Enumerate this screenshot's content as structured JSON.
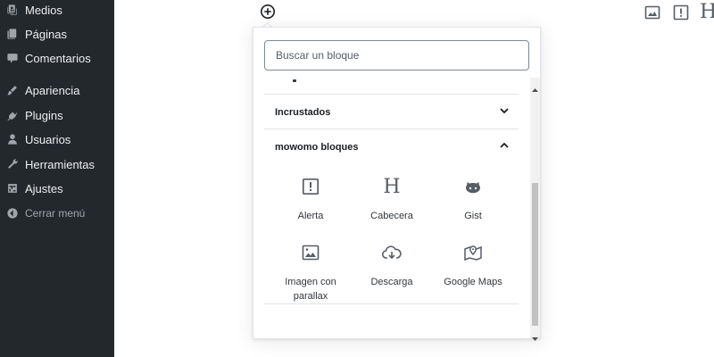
{
  "sidebar": {
    "items": [
      {
        "label": "Medios",
        "icon": "media-icon"
      },
      {
        "label": "Páginas",
        "icon": "pages-icon"
      },
      {
        "label": "Comentarios",
        "icon": "comments-icon"
      },
      {
        "label": "Apariencia",
        "icon": "appearance-icon"
      },
      {
        "label": "Plugins",
        "icon": "plugins-icon"
      },
      {
        "label": "Usuarios",
        "icon": "users-icon"
      },
      {
        "label": "Herramientas",
        "icon": "tools-icon"
      },
      {
        "label": "Ajustes",
        "icon": "settings-icon"
      }
    ],
    "collapse_label": "Cerrar menú"
  },
  "toolbar": {
    "inserter_icon": "plus-circle-icon",
    "right_icons": [
      "image-icon",
      "alert-icon",
      "heading-icon"
    ],
    "heading_glyph": "H"
  },
  "inserter": {
    "search_placeholder": "Buscar un bloque",
    "panels": [
      {
        "title": "Incrustados",
        "expanded": false
      },
      {
        "title": "mowomo bloques",
        "expanded": true
      }
    ],
    "blocks": [
      {
        "label": "Alerta",
        "icon": "alert-icon"
      },
      {
        "label": "Cabecera",
        "icon": "heading-icon",
        "glyph": "H"
      },
      {
        "label": "Gist",
        "icon": "github-icon"
      },
      {
        "label": "Imagen con parallax",
        "icon": "image-icon"
      },
      {
        "label": "Descarga",
        "icon": "cloud-download-icon"
      },
      {
        "label": "Google Maps",
        "icon": "map-pin-icon"
      }
    ]
  },
  "colors": {
    "sidebar_bg": "#23282d",
    "sidebar_text": "#eeeeee",
    "sidebar_icon": "#a0a5aa",
    "icon_dark": "#555d66",
    "text_dark": "#191e23"
  }
}
